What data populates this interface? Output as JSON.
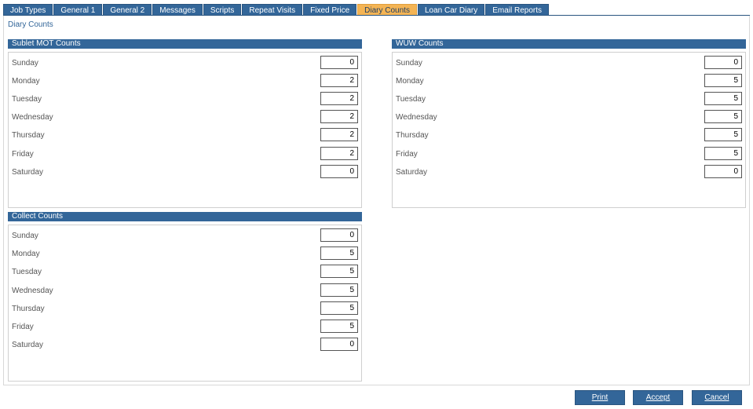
{
  "tabs": [
    {
      "label": "Job Types",
      "active": false
    },
    {
      "label": "General 1",
      "active": false
    },
    {
      "label": "General 2",
      "active": false
    },
    {
      "label": "Messages",
      "active": false
    },
    {
      "label": "Scripts",
      "active": false
    },
    {
      "label": "Repeat Visits",
      "active": false
    },
    {
      "label": "Fixed Price",
      "active": false
    },
    {
      "label": "Diary Counts",
      "active": true
    },
    {
      "label": "Loan Car Diary",
      "active": false
    },
    {
      "label": "Email Reports",
      "active": false
    }
  ],
  "page_title": "Diary Counts",
  "sublet_mot": {
    "title": "Sublet MOT Counts",
    "rows": [
      {
        "day": "Sunday",
        "value": "0"
      },
      {
        "day": "Monday",
        "value": "2"
      },
      {
        "day": "Tuesday",
        "value": "2"
      },
      {
        "day": "Wednesday",
        "value": "2"
      },
      {
        "day": "Thursday",
        "value": "2"
      },
      {
        "day": "Friday",
        "value": "2"
      },
      {
        "day": "Saturday",
        "value": "0"
      }
    ]
  },
  "wuw": {
    "title": "WUW Counts",
    "rows": [
      {
        "day": "Sunday",
        "value": "0"
      },
      {
        "day": "Monday",
        "value": "5"
      },
      {
        "day": "Tuesday",
        "value": "5"
      },
      {
        "day": "Wednesday",
        "value": "5"
      },
      {
        "day": "Thursday",
        "value": "5"
      },
      {
        "day": "Friday",
        "value": "5"
      },
      {
        "day": "Saturday",
        "value": "0"
      }
    ]
  },
  "collect": {
    "title": "Collect Counts",
    "rows": [
      {
        "day": "Sunday",
        "value": "0"
      },
      {
        "day": "Monday",
        "value": "5"
      },
      {
        "day": "Tuesday",
        "value": "5"
      },
      {
        "day": "Wednesday",
        "value": "5"
      },
      {
        "day": "Thursday",
        "value": "5"
      },
      {
        "day": "Friday",
        "value": "5"
      },
      {
        "day": "Saturday",
        "value": "0"
      }
    ]
  },
  "buttons": {
    "print": "Print",
    "accept": "Accept",
    "cancel": "Cancel"
  },
  "colors": {
    "header_blue": "#336699",
    "active_tab": "#f4b454"
  }
}
